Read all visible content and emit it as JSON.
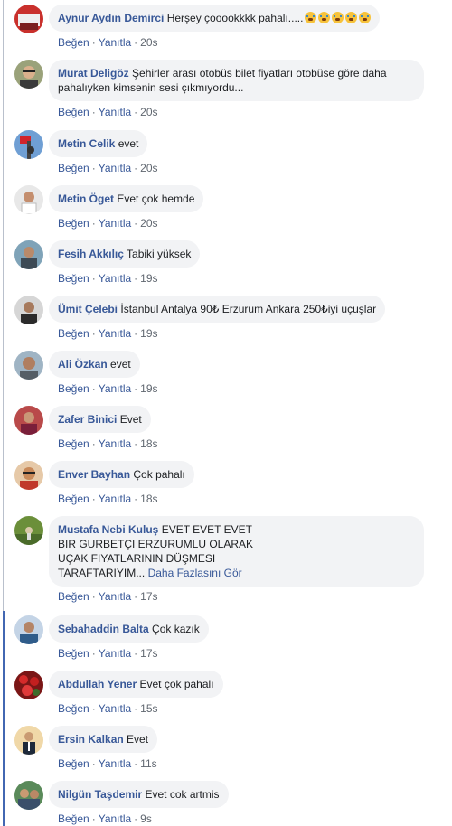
{
  "actions": {
    "like": "Beğen",
    "reply": "Yanıtla",
    "sep": "·"
  },
  "comments": [
    {
      "name": "Aynur Aydın Demirci",
      "text": "Herşey çooookkkk pahalı.....",
      "emoji": "crying-face",
      "time": "20s"
    },
    {
      "name": "Murat Deligöz",
      "text": "Şehirler arası otobüs bilet fiyatları otobüse göre daha",
      "text2": "pahalıyken kimsenin sesi çıkmıyordu...",
      "time": "20s"
    },
    {
      "name": "Metin Celik",
      "text": "evet",
      "time": "20s"
    },
    {
      "name": "Metin Öget",
      "text": "Evet çok hemde",
      "time": "20s"
    },
    {
      "name": "Fesih Akkılıç",
      "text": "Tabiki yüksek",
      "time": "19s"
    },
    {
      "name": "Ümit Çelebi",
      "text": "İstanbul Antalya 90₺ Erzurum Ankara 250₺iyi uçuşlar",
      "time": "19s"
    },
    {
      "name": "Ali Özkan",
      "text": "evet",
      "time": "19s"
    },
    {
      "name": "Zafer Binici",
      "text": "Evet",
      "time": "18s"
    },
    {
      "name": "Enver Bayhan",
      "text": "Çok pahalı",
      "time": "18s"
    },
    {
      "name": "Mustafa Nebi Kuluş",
      "text": "EVET EVET EVET",
      "line2": "BIR GURBETÇI ERZURUMLU OLARAK",
      "line3": "UÇAK FIYATLARININ DÜŞMESI",
      "line4": "TARAFTARIYIM...",
      "more": "Daha Fazlasını Gör",
      "time": "17s"
    },
    {
      "name": "Sebahaddin Balta",
      "text": "Çok kazık",
      "time": "17s"
    },
    {
      "name": "Abdullah Yener",
      "text": "Evet çok pahalı",
      "time": "15s"
    },
    {
      "name": "Ersin Kalkan",
      "text": "Evet",
      "time": "11s"
    },
    {
      "name": "Nilgün Taşdemir",
      "text": "Evet cok artmis",
      "time": "9s"
    }
  ],
  "colors": {
    "link": "#385898",
    "bubble": "#f2f3f5",
    "meta": "#606770",
    "thread": "#4267b2"
  }
}
